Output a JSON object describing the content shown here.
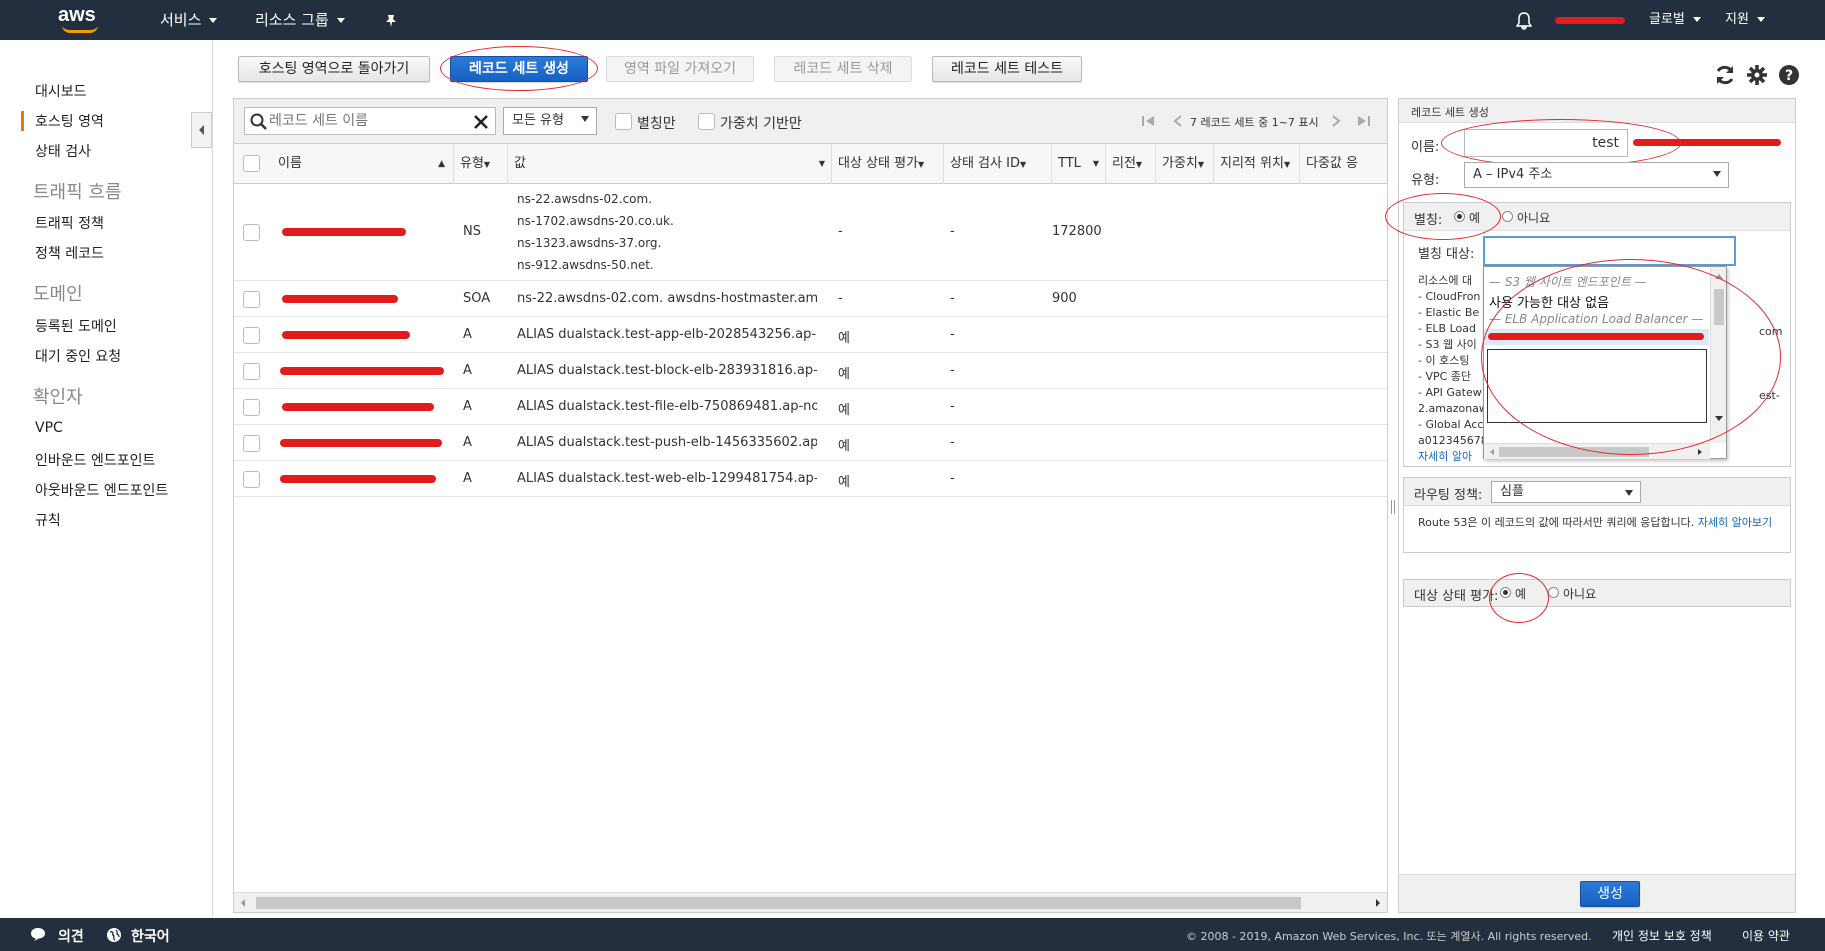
{
  "topbar": {
    "logo": "aws",
    "services": "서비스",
    "resource_groups": "리소스 그룹",
    "bell_icon": "bell-icon",
    "region": "글로벌",
    "support": "지원"
  },
  "sidebar": {
    "items": [
      "대시보드",
      "호스팅 영역",
      "상태 검사"
    ],
    "traffic_head": "트래픽 흐름",
    "traffic_items": [
      "트래픽 정책",
      "정책 레코드"
    ],
    "domain_head": "도메인",
    "domain_items": [
      "등록된 도메인",
      "대기 중인 요청"
    ],
    "resolver_head": "확인자",
    "resolver_items": [
      "VPC",
      "인바운드 엔드포인트",
      "아웃바운드 엔드포인트",
      "규칙"
    ]
  },
  "toolbar": {
    "back": "호스팅 영역으로 돌아가기",
    "create": "레코드 세트 생성",
    "import": "영역 파일 가져오기",
    "delete": "레코드 세트 삭제",
    "test": "레코드 세트 테스트"
  },
  "filter": {
    "search_placeholder": "레코드 세트 이름",
    "type_select": "모든 유형",
    "alias_only": "별칭만",
    "weighted": "가중치 기반만",
    "pager": "7 레코드 세트 중 1~7 표시"
  },
  "table": {
    "columns": [
      "이름",
      "유형",
      "값",
      "대상 상태 평가",
      "상태 검사 ID",
      "TTL",
      "리전",
      "가중치",
      "지리적 위치",
      "다중값 응"
    ],
    "rows": [
      {
        "type": "NS",
        "values": [
          "ns-22.awsdns-02.com.",
          "ns-1702.awsdns-20.co.uk.",
          "ns-1323.awsdns-37.org.",
          "ns-912.awsdns-50.net."
        ],
        "eval": "-",
        "hc": "-",
        "ttl": "172800"
      },
      {
        "type": "SOA",
        "values": [
          "ns-22.awsdns-02.com. awsdns-hostmaster.amazon."
        ],
        "eval": "-",
        "hc": "-",
        "ttl": "900"
      },
      {
        "type": "A",
        "values": [
          "ALIAS dualstack.test-app-elb-2028543256.ap-northe"
        ],
        "eval": "예",
        "hc": "-",
        "ttl": ""
      },
      {
        "type": "A",
        "values": [
          "ALIAS dualstack.test-block-elb-283931816.ap-northe"
        ],
        "eval": "예",
        "hc": "-",
        "ttl": ""
      },
      {
        "type": "A",
        "values": [
          "ALIAS dualstack.test-file-elb-750869481.ap-northea"
        ],
        "eval": "예",
        "hc": "-",
        "ttl": ""
      },
      {
        "type": "A",
        "values": [
          "ALIAS dualstack.test-push-elb-1456335602.ap-northe"
        ],
        "eval": "예",
        "hc": "-",
        "ttl": ""
      },
      {
        "type": "A",
        "values": [
          "ALIAS dualstack.test-web-elb-1299481754.ap-northe"
        ],
        "eval": "예",
        "hc": "-",
        "ttl": ""
      }
    ]
  },
  "panel": {
    "title": "레코드 세트 생성",
    "name_label": "이름:",
    "name_value": "test",
    "type_label": "유형:",
    "type_value": "A – IPv4 주소",
    "alias_label": "별칭:",
    "yes": "예",
    "no": "아니요",
    "alias_target_label": "별칭 대상:",
    "desc_lines": [
      "리소스에 대",
      "- CloudFron",
      "- Elastic Be",
      "- ELB Load",
      "- S3 웹 사이",
      "- 이 호스팅",
      "- VPC 종단",
      "- API Gatew",
      "2.amazonaw",
      "- Global Acc",
      "a012345678"
    ],
    "desc_suffix_1": "com",
    "desc_suffix_2": "est-",
    "learn_more": "자세히 알아",
    "dropdown": {
      "s3_header": "— S3 웹 사이트 엔드포인트 —",
      "no_targets": "사용 가능한 대상 없음",
      "elb_header": "— ELB Application Load Balancer —"
    },
    "routing_label": "라우팅 정책:",
    "routing_value": "심플",
    "routing_desc": "Route 53은 이 레코드의 값에 따라서만 쿼리에 응답합니다.",
    "routing_learn": "자세히 알아보기",
    "eval_label": "대상 상태 평가:",
    "create_btn": "생성"
  },
  "footer": {
    "feedback": "의견",
    "language": "한국어",
    "copyright": "© 2008 - 2019, Amazon Web Services, Inc. 또는 계열사. All rights reserved.",
    "privacy": "개인 정보 보호 정책",
    "terms": "이용 약관"
  },
  "colors": {
    "nav": "#232f3e",
    "accent": "#ff9900",
    "primary": "#1662c4",
    "annotation": "#e32a2a"
  }
}
